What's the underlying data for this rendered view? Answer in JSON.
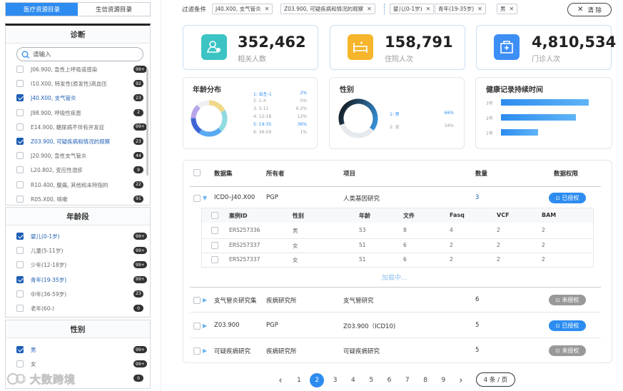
{
  "left": {
    "tabs": [
      "医疗资源目录",
      "生信资源目录"
    ],
    "diagnosis": {
      "title": "诊断",
      "search_placeholder": "请输入",
      "items": [
        {
          "label": "J06.900, 急性上呼吸道感染",
          "count": "99+",
          "checked": false
        },
        {
          "label": "I10.X00, 特发性(原发性)高血压",
          "count": "92",
          "checked": false
        },
        {
          "label": "J40.X00, 支气管炎",
          "count": "23",
          "checked": true
        },
        {
          "label": "J98.900, 呼吸性疾患",
          "count": "2",
          "checked": false
        },
        {
          "label": "E14.900, 糖尿病不伴有并发症",
          "count": "99+",
          "checked": false
        },
        {
          "label": "Z03.900, 可疑疾病和情况的观察",
          "count": "23",
          "checked": true
        },
        {
          "label": "J20.900, 急性支气管炎",
          "count": "44",
          "checked": false
        },
        {
          "label": "L20.802, 变应性湿疹",
          "count": "9",
          "checked": false
        },
        {
          "label": "R10.400, 腹痛, 其他和未特指的",
          "count": "22",
          "checked": false
        },
        {
          "label": "R05.X00, 咳嗽",
          "count": "91",
          "checked": false
        }
      ]
    },
    "age": {
      "title": "年龄段",
      "items": [
        {
          "label": "婴儿(0-1岁)",
          "count": "99+",
          "checked": true
        },
        {
          "label": "儿童(5-11岁)",
          "count": "99+",
          "checked": false
        },
        {
          "label": "少年(12-18岁)",
          "count": "99+",
          "checked": false
        },
        {
          "label": "青年(19-35岁)",
          "count": "99+",
          "checked": true
        },
        {
          "label": "中年(36-59岁)",
          "count": "23",
          "checked": false
        },
        {
          "label": "老年(60-)",
          "count": "0",
          "checked": false
        }
      ]
    },
    "gender": {
      "title": "性别",
      "items": [
        {
          "label": "男",
          "count": "99+",
          "checked": true
        },
        {
          "label": "女",
          "count": "99+",
          "checked": false
        },
        {
          "label": "",
          "count": "0",
          "checked": false
        }
      ]
    },
    "watermark": "大数跨境"
  },
  "filter": {
    "label": "过滤条件",
    "chips": [
      "J40.X00, 支气管炎",
      "Z03.900, 可疑疾病和情况的观察",
      "婴儿(0-1岁)",
      "青年(19-35岁)",
      "男"
    ],
    "clear": "清 除"
  },
  "stats": [
    {
      "value": "352,462",
      "label": "相关人数",
      "icon": "people-icon",
      "color": "#3cc4c4"
    },
    {
      "value": "158,791",
      "label": "住院人次",
      "icon": "bed-icon",
      "color": "#f6b52a"
    },
    {
      "value": "4,810,534",
      "label": "门诊人次",
      "icon": "clinic-icon",
      "color": "#3d8ef5"
    }
  ],
  "age_dist": {
    "title": "年龄分布",
    "legend": [
      {
        "name": "1: 出生-1",
        "pct": "2%",
        "hl": true
      },
      {
        "name": "2: 1-4",
        "pct": "5%",
        "hl": false
      },
      {
        "name": "3: 5-11",
        "pct": "6.2%",
        "hl": false
      },
      {
        "name": "4: 12-18",
        "pct": "12%",
        "hl": false
      },
      {
        "name": "5: 19-35",
        "pct": "36%",
        "hl": true
      },
      {
        "name": "6: 36-59",
        "pct": "1%",
        "hl": false
      }
    ]
  },
  "gender_dist": {
    "title": "性别",
    "legend": [
      {
        "name": "1: 男",
        "pct": "66%",
        "hl": true
      },
      {
        "name": "2: 女",
        "pct": "34%",
        "hl": false
      }
    ]
  },
  "duration": {
    "title": "健康记录持续时间",
    "bars": [
      {
        "label": "3年",
        "value": 1.0
      },
      {
        "label": "2年",
        "value": 0.85
      },
      {
        "label": "1年",
        "value": 0.42
      }
    ]
  },
  "table": {
    "headers": [
      "数据集",
      "所有者",
      "项目",
      "数量",
      "数据权限"
    ],
    "rows": [
      {
        "dataset": "ICD0–J40.X00",
        "owner": "PGP",
        "project": "人类基因研究",
        "count": "3",
        "perm": "已授权",
        "auth": true,
        "expanded": true
      },
      {
        "dataset": "支气管炎研究集",
        "owner": "疾病研究所",
        "project": "支气管研究",
        "count": "6",
        "perm": "未授权",
        "auth": false,
        "expanded": false
      },
      {
        "dataset": "Z03.900",
        "owner": "PGP",
        "project": "Z03.900（ICD10)",
        "count": "5",
        "perm": "已授权",
        "auth": true,
        "expanded": false
      },
      {
        "dataset": "可疑疾病研究",
        "owner": "疾病研究所",
        "project": "可疑疾病研究",
        "count": "5",
        "perm": "未授权",
        "auth": false,
        "expanded": false
      }
    ],
    "sub_headers": [
      "案例ID",
      "性别",
      "年龄",
      "文件",
      "Fasq",
      "VCF",
      "BAM"
    ],
    "sub_rows": [
      [
        "ERS257336",
        "男",
        "53",
        "8",
        "4",
        "2",
        "2"
      ],
      [
        "ERS257337",
        "女",
        "51",
        "6",
        "2",
        "2",
        "2"
      ],
      [
        "ERS257337",
        "女",
        "51",
        "6",
        "2",
        "2",
        "2"
      ]
    ],
    "loading": "加载中..."
  },
  "pagination": {
    "pages": [
      "1",
      "2",
      "3",
      "4",
      "5",
      "6",
      "7",
      "8",
      "9"
    ],
    "current": "2",
    "page_size": "4 条 / 页",
    "prev": "‹",
    "next": "›"
  }
}
